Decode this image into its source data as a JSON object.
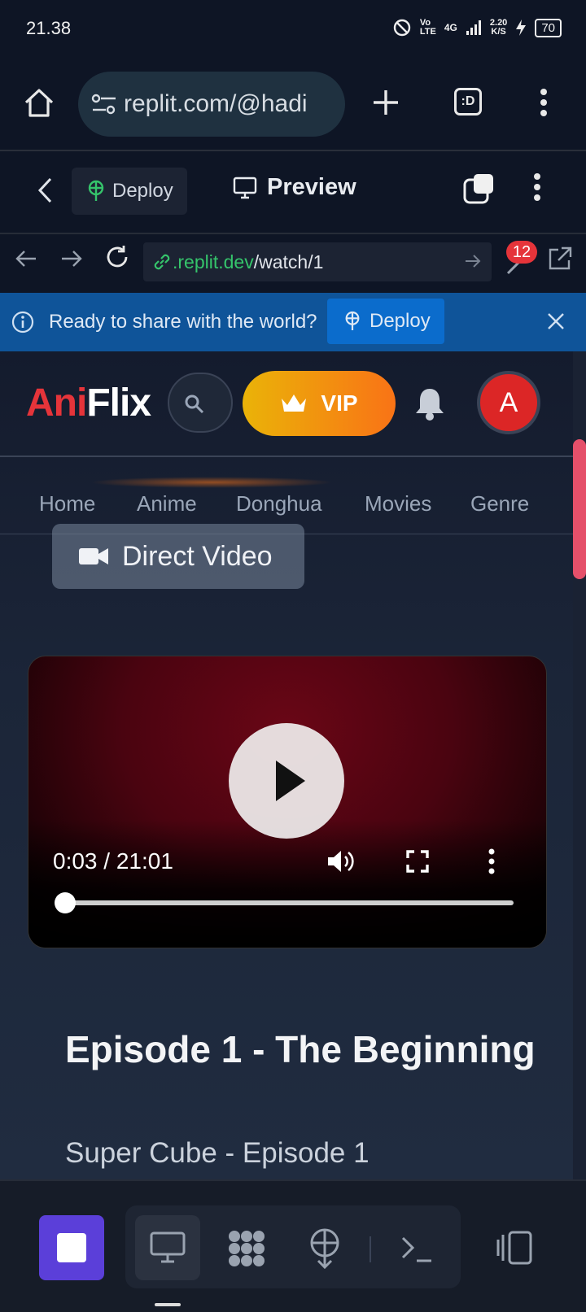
{
  "status": {
    "time": "21.38",
    "network": "4G",
    "speed_top": "2.20",
    "speed_bottom": "K/S",
    "battery": "70"
  },
  "browser": {
    "url": "replit.com/@hadi",
    "tab_icon_label": ":D"
  },
  "replit": {
    "deploy_label": "Deploy",
    "preview_label": "Preview"
  },
  "webview": {
    "url_domain": ".replit.dev",
    "url_path": "/watch/1",
    "notification_count": "12"
  },
  "banner": {
    "text": "Ready to share with the world?",
    "button_label": "Deploy"
  },
  "site": {
    "logo_part1": "Ani",
    "logo_part2": "Flix",
    "vip_label": "VIP",
    "avatar_letter": "A",
    "nav": [
      "Home",
      "Anime",
      "Donghua",
      "Movies",
      "Genre"
    ],
    "direct_video_label": "Direct Video"
  },
  "video": {
    "time_display": "0:03 / 21:01",
    "progress_fraction": 0.0024
  },
  "episode": {
    "title": "Episode 1 - The Beginning",
    "subtitle": "Super Cube - Episode 1"
  },
  "colors": {
    "accent_red": "#e5343a",
    "vip_start": "#eab308",
    "vip_end": "#f97316",
    "banner_blue": "#0f5499",
    "stop_purple": "#5b3fd9"
  }
}
